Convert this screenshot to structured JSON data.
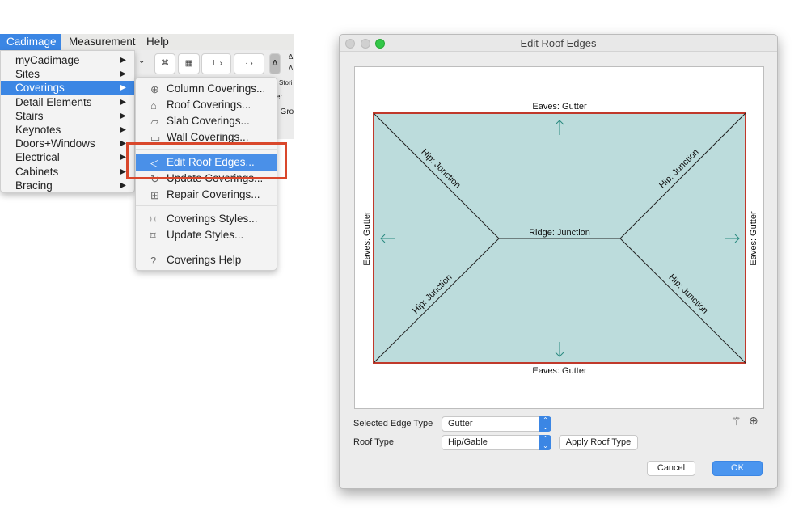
{
  "menubar": {
    "items": [
      "Cadimage",
      "Measurement",
      "Help"
    ]
  },
  "toolbar": {
    "partial_texts": [
      "Δ:",
      "Δ:",
      "l Stori",
      "e:",
      ". Gro"
    ]
  },
  "main_menu": {
    "items": [
      {
        "label": "myCadimage"
      },
      {
        "label": "Sites"
      },
      {
        "label": "Coverings",
        "selected": true
      },
      {
        "label": "Detail Elements"
      },
      {
        "label": "Stairs"
      },
      {
        "label": "Keynotes"
      },
      {
        "label": "Doors+Windows"
      },
      {
        "label": "Electrical"
      },
      {
        "label": "Cabinets"
      },
      {
        "label": "Bracing"
      }
    ]
  },
  "submenu": {
    "items": [
      {
        "label": "Column Coverings...",
        "icon": "column-icon"
      },
      {
        "label": "Roof Coverings...",
        "icon": "roof-icon"
      },
      {
        "label": "Slab Coverings...",
        "icon": "slab-icon"
      },
      {
        "label": "Wall Coverings...",
        "icon": "wall-icon"
      },
      {
        "label": "Edit Roof Edges...",
        "icon": "roof-edge-icon",
        "selected": true
      },
      {
        "label": "Update Coverings...",
        "icon": "refresh-icon"
      },
      {
        "label": "Repair Coverings...",
        "icon": "repair-icon"
      },
      {
        "label": "Coverings Styles...",
        "icon": "bookmark-icon"
      },
      {
        "label": "Update Styles...",
        "icon": "bookmark-update-icon"
      },
      {
        "label": "Coverings Help",
        "icon": "help-icon"
      }
    ]
  },
  "highlight_color": "#d9472b",
  "dialog": {
    "title": "Edit Roof Edges",
    "diagram": {
      "top": "Eaves: Gutter",
      "bottom": "Eaves: Gutter",
      "left": "Eaves: Gutter",
      "right": "Eaves: Gutter",
      "ridge": "Ridge: Junction",
      "hips": [
        "Hip: Junction",
        "Hip: Junction",
        "Hip: Junction",
        "Hip: Junction"
      ],
      "fill": "#bcdcdc",
      "outline": "#c0392b"
    },
    "selected_edge_type_label": "Selected Edge Type",
    "selected_edge_type": "Gutter",
    "roof_type_label": "Roof Type",
    "roof_type": "Hip/Gable",
    "apply_label": "Apply Roof Type",
    "cancel_label": "Cancel",
    "ok_label": "OK"
  }
}
